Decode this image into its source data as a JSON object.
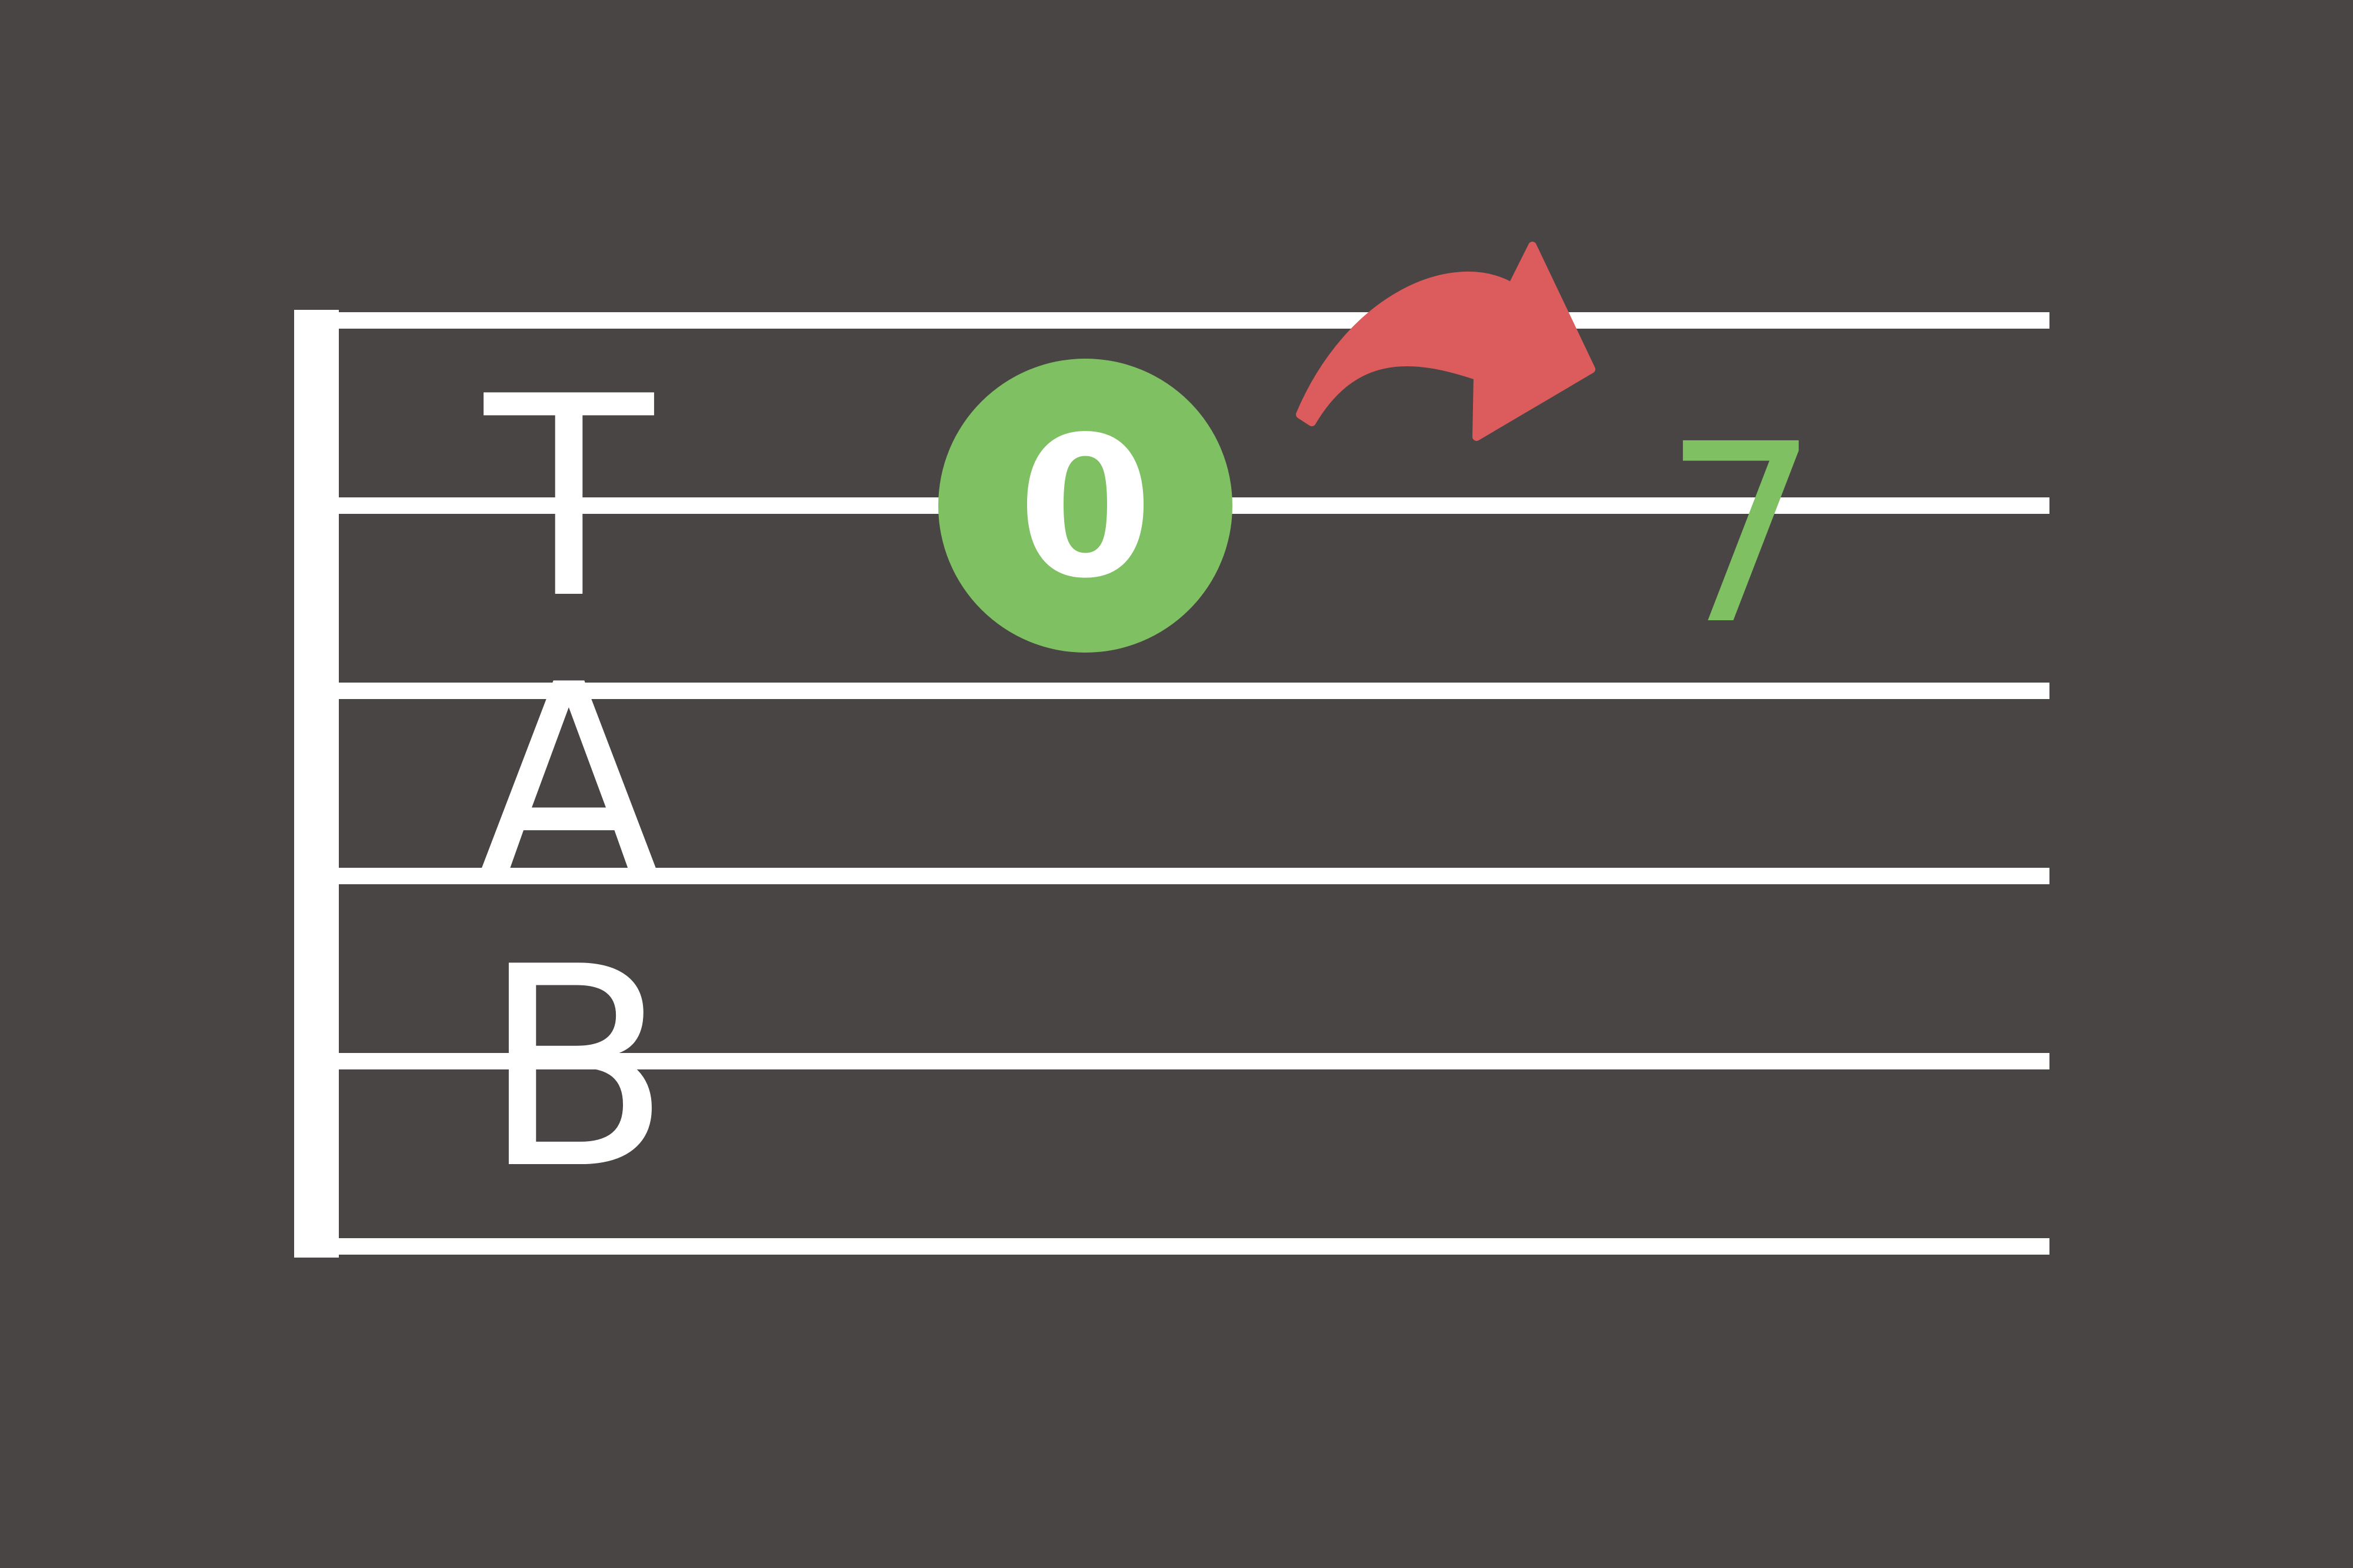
{
  "colors": {
    "background": "#494544",
    "staff": "#ffffff",
    "highlight": "#7ec062",
    "arrow": "#dc5b5c",
    "text_on_highlight": "#ffffff"
  },
  "tab_clef": {
    "letters": [
      "T",
      "A",
      "B"
    ]
  },
  "staff": {
    "string_count": 6
  },
  "notes": {
    "open_note": "0",
    "target_note": "7"
  },
  "icons": {
    "arrow": "curved-arrow-right-icon"
  }
}
